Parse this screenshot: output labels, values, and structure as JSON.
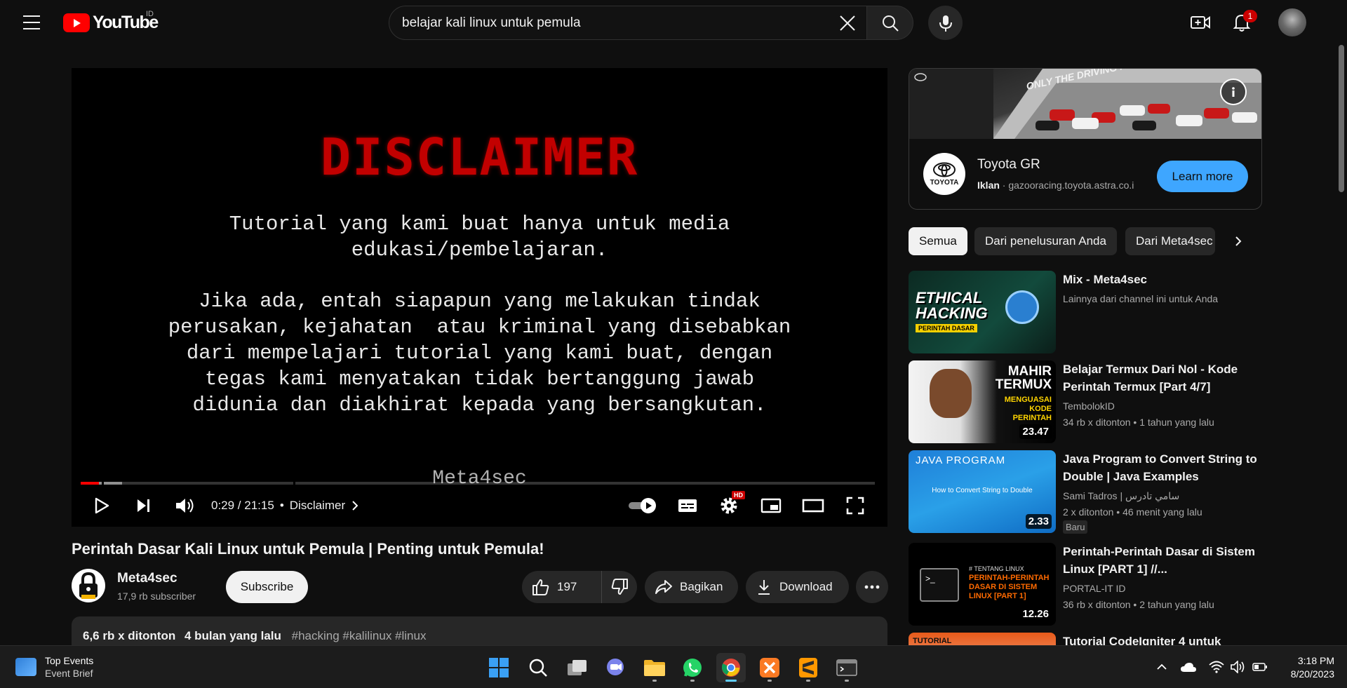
{
  "header": {
    "logo_text": "YouTube",
    "region": "ID",
    "search_value": "belajar kali linux untuk pemula",
    "notification_count": "1"
  },
  "player": {
    "disclaimer_title": "DISCLAIMER",
    "disclaimer_p1": "Tutorial yang kami buat hanya untuk media\nedukasi/pembelajaran.",
    "disclaimer_p2": "Jika ada, entah siapapun yang melakukan tindak\nperusakan, kejahatan  atau kriminal yang disebabkan\ndari mempelajari tutorial yang kami buat, dengan\ntegas kami menyatakan tidak bertanggung jawab\ndidunia dan diakhirat kepada yang bersangkutan.",
    "watermark": "Meta4sec",
    "time": "0:29 / 21:15",
    "separator": "•",
    "chapter": "Disclaimer",
    "progress_played": 0.023,
    "progress_buffered": 0.052,
    "hd_badge": "HD"
  },
  "video": {
    "title": "Perintah Dasar Kali Linux untuk Pemula | Penting untuk Pemula!",
    "channel_name": "Meta4sec",
    "subscribers": "17,9 rb subscriber",
    "subscribe_label": "Subscribe",
    "likes": "197",
    "share_label": "Bagikan",
    "download_label": "Download",
    "views": "6,6 rb x ditonton",
    "uploaded": "4 bulan yang lalu",
    "tags": "#hacking #kalilinux #linux"
  },
  "ad": {
    "title": "Toyota GR",
    "label": "Iklan",
    "url": "gazooracing.toyota.astra.co.i",
    "cta": "Learn more",
    "logo_text": "TOYOTA",
    "banner_text": "ONLY THE DRIVING PASSION"
  },
  "chips": [
    "Semua",
    "Dari penelusuran Anda",
    "Dari Meta4sec"
  ],
  "recommendations": [
    {
      "title": "Mix - Meta4sec",
      "line1": "Lainnya dari channel ini untuk Anda",
      "line2": "",
      "duration": "",
      "thumb_text": "ETHICAL HACKING",
      "thumb_sub": "PERINTAH DASAR"
    },
    {
      "title": "Belajar Termux Dari Nol - Kode Perintah Termux [Part 4/7]",
      "line1": "TembolokID",
      "line2": "34 rb x ditonton  • 1 tahun yang lalu",
      "duration": "23.47",
      "thumb_text": "MAHIR TERMUX",
      "thumb_sub": "MENGUASAI KODE PERINTAH"
    },
    {
      "title": "Java Program to Convert String to Double | Java Examples",
      "line1": "Sami Tadros | سامي تادرس",
      "line2": "2 x ditonton  • 46 menit yang lalu",
      "badge": "Baru",
      "duration": "2.33",
      "thumb_text": "JAVA PROGRAM",
      "thumb_sub": "How to Convert String to Double"
    },
    {
      "title": "Perintah-Perintah Dasar di Sistem Linux [PART 1] //...",
      "line1": "PORTAL-IT ID",
      "line2": "36 rb x ditonton  • 2 tahun yang lalu",
      "duration": "12.26",
      "thumb_text": "# TENTANG LINUX",
      "thumb_sub": "PERINTAH-PERINTAH DASAR DI SISTEM LINUX [PART 1]"
    },
    {
      "title": "Tutorial CodeIgniter 4 untuk",
      "line1": "",
      "line2": "",
      "duration": "",
      "thumb_text": "TUTORIAL",
      "thumb_sub": ""
    }
  ],
  "taskbar": {
    "widget_title": "Top Events",
    "widget_sub": "Event Brief",
    "time": "3:18 PM",
    "date": "8/20/2023"
  },
  "colors": {
    "background": "#0f0f0f",
    "brand_red": "#ff0000",
    "accent_blue": "#3ea6ff",
    "pill_bg": "#272727"
  }
}
